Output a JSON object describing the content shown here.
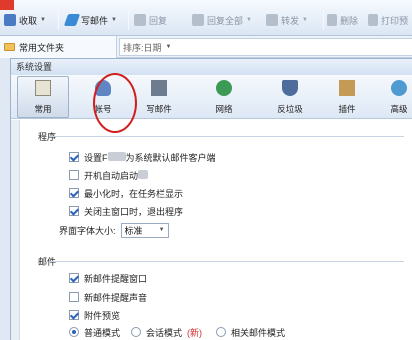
{
  "toolbar": {
    "receive": "收取",
    "compose": "写邮件",
    "reply": "回复",
    "reply_all": "回复全部",
    "forward": "转发",
    "delete": "删除",
    "print": "打印预"
  },
  "folder_pane": {
    "label": "常用文件夹"
  },
  "sort": {
    "label": "排序:日期"
  },
  "dialog": {
    "title": "系统设置",
    "categories": [
      {
        "label": "常用",
        "icon": "general-icon"
      },
      {
        "label": "帐号",
        "icon": "account-icon"
      },
      {
        "label": "写邮件",
        "icon": "compose-icon"
      },
      {
        "label": "网络",
        "icon": "network-icon"
      },
      {
        "label": "反垃圾",
        "icon": "antispam-icon"
      },
      {
        "label": "插件",
        "icon": "plugin-icon"
      },
      {
        "label": "高级",
        "icon": "advanced-icon"
      }
    ],
    "active_category": "常用"
  },
  "program": {
    "heading": "程序",
    "opt_default_client_a": "设置F",
    "opt_default_client_b": "为系统默认邮件客户端",
    "opt_autostart": "开机自动启动",
    "opt_tray": "最小化时，在任务栏显示",
    "opt_exit_on_close": "关闭主窗口时，退出程序",
    "font_size_label": "界面字体大小:",
    "font_size_value": "标准"
  },
  "mail": {
    "heading": "邮件",
    "opt_new_window": "新邮件提醒窗口",
    "opt_new_sound": "新邮件提醒声音",
    "opt_attach_preview": "附件预览",
    "mode_normal": "普通模式",
    "mode_conversation": "会话模式",
    "mode_new_badge": "(新)",
    "mode_related": "相关邮件模式"
  },
  "colors": {
    "accent": "#2a63b8",
    "highlight_circle": "#d11f1f"
  }
}
